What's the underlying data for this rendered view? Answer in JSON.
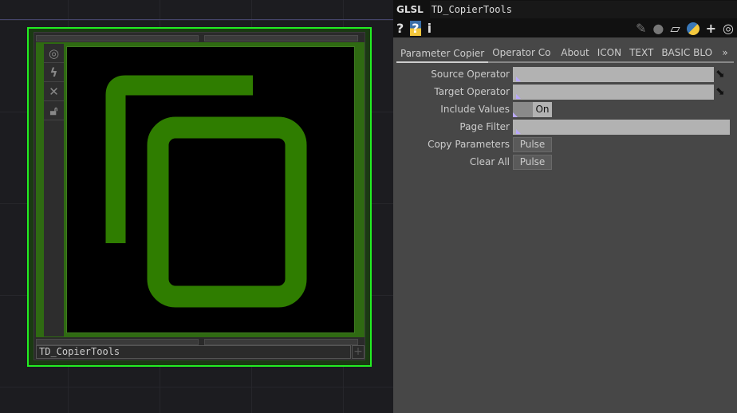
{
  "node": {
    "name": "TD_CopierTools",
    "side_buttons": [
      "viewer-toggle-icon",
      "bypass-icon",
      "close-icon",
      "lock-icon"
    ],
    "accent": "#22ee22",
    "icon_color": "#2f7d00"
  },
  "panel": {
    "type": "GLSL",
    "name": "TD_CopierTools",
    "tabs": [
      "Parameter Copier",
      "Operator Co",
      "About",
      "ICON",
      "TEXT",
      "BASIC BLO"
    ],
    "more": "»",
    "params": {
      "source": {
        "label": "Source Operator",
        "value": ""
      },
      "target": {
        "label": "Target Operator",
        "value": ""
      },
      "include": {
        "label": "Include Values",
        "value": "On"
      },
      "filter": {
        "label": "Page Filter",
        "value": ""
      },
      "copy": {
        "label": "Copy Parameters",
        "value": "Pulse"
      },
      "clear": {
        "label": "Clear All",
        "value": "Pulse"
      }
    },
    "icons": {
      "help": "?",
      "info": "i"
    }
  }
}
